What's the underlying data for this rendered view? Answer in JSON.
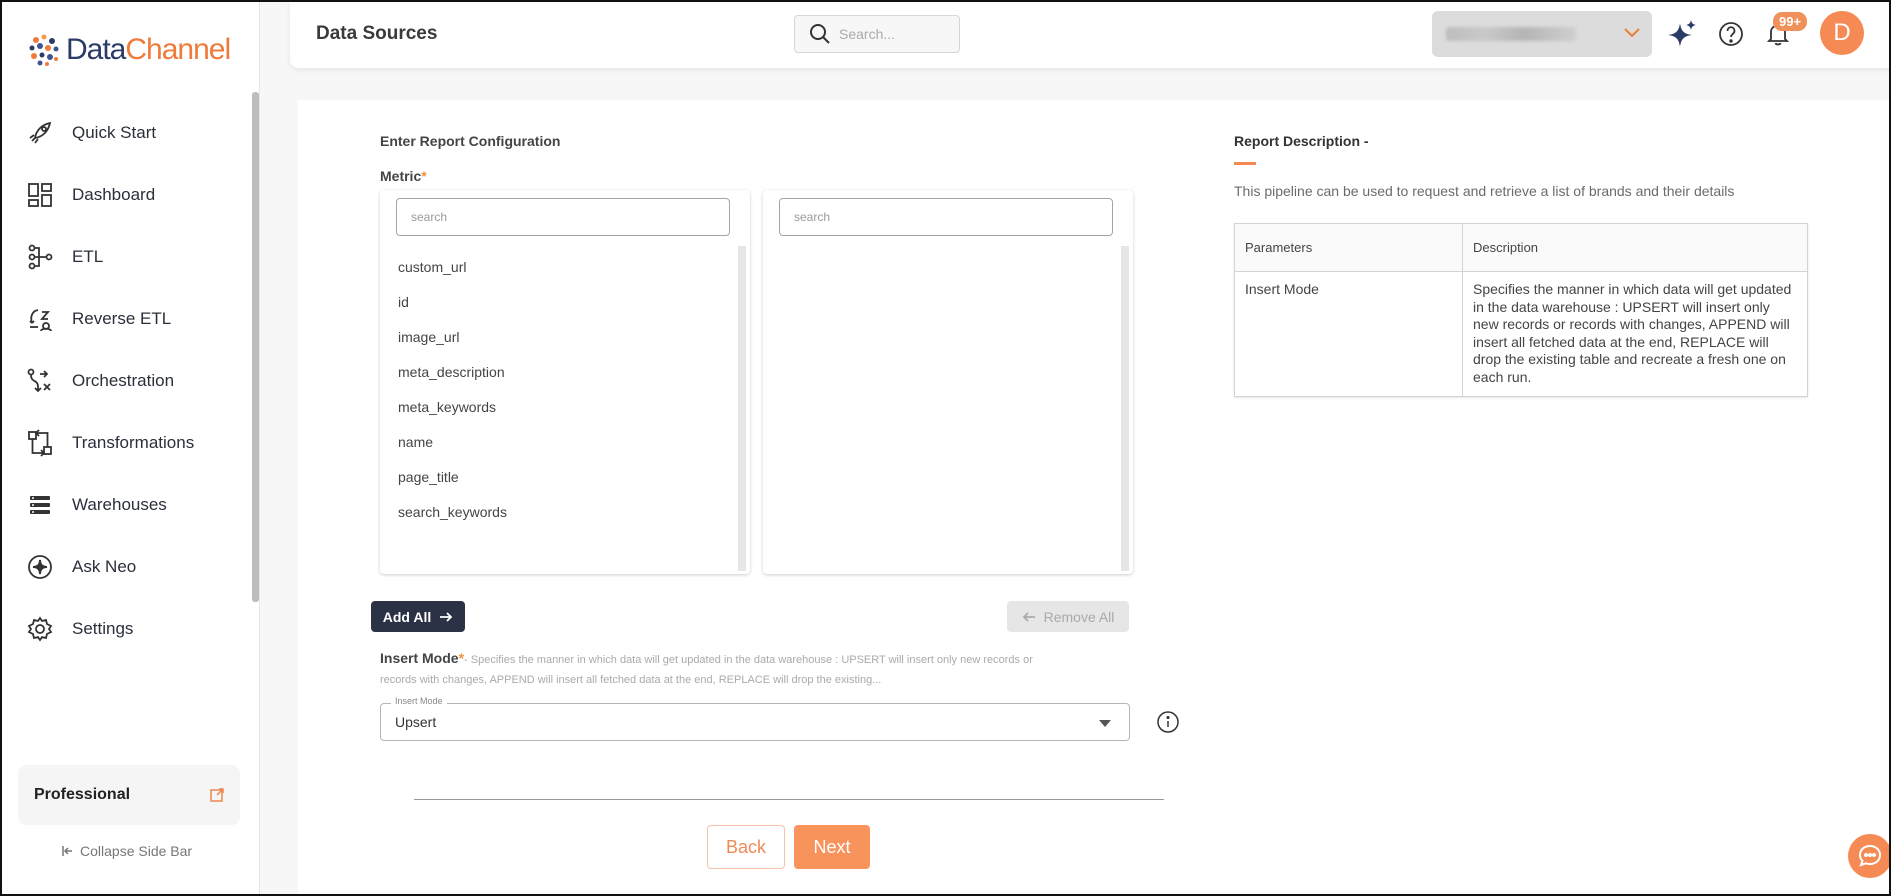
{
  "brand": {
    "name_part1": "Data",
    "name_part2": "Channel",
    "primary": "#2b3a67",
    "accent": "#ef7a3a"
  },
  "sidebar": {
    "items": [
      {
        "label": "Quick Start",
        "icon": "rocket-icon"
      },
      {
        "label": "Dashboard",
        "icon": "dashboard-icon"
      },
      {
        "label": "ETL",
        "icon": "etl-icon"
      },
      {
        "label": "Reverse ETL",
        "icon": "reverse-etl-icon"
      },
      {
        "label": "Orchestration",
        "icon": "orchestration-icon"
      },
      {
        "label": "Transformations",
        "icon": "transformations-icon"
      },
      {
        "label": "Warehouses",
        "icon": "warehouses-icon"
      },
      {
        "label": "Ask Neo",
        "icon": "sparkle-icon"
      },
      {
        "label": "Settings",
        "icon": "gear-icon"
      }
    ],
    "plan_name": "Professional",
    "collapse_label": "Collapse Side Bar"
  },
  "header": {
    "title": "Data Sources",
    "search_placeholder": "Search...",
    "notification_count": "99+",
    "avatar_initial": "D"
  },
  "config": {
    "section_title": "Enter Report Configuration",
    "metric_label": "Metric",
    "required_mark": "*",
    "available_search_placeholder": "search",
    "selected_search_placeholder": "search",
    "available_metrics": [
      "custom_url",
      "id",
      "image_url",
      "meta_description",
      "meta_keywords",
      "name",
      "page_title",
      "search_keywords"
    ],
    "add_all_label": "Add All",
    "remove_all_label": "Remove All",
    "insert_mode_label": "Insert Mode",
    "insert_mode_hint": "- Specifies the manner in which data will get updated in the data warehouse : UPSERT will insert only new records or records with changes, APPEND will insert all fetched data at the end, REPLACE will drop the existing...",
    "insert_mode_field_label": "Insert Mode",
    "insert_mode_value": "Upsert",
    "back_label": "Back",
    "next_label": "Next"
  },
  "report_description": {
    "title": "Report Description -",
    "text": "This pipeline can be used to request and retrieve a list of brands and their details",
    "columns": [
      "Parameters",
      "Description"
    ],
    "rows": [
      {
        "parameter": "Insert Mode",
        "description": "Specifies the manner in which data will get updated in the data warehouse : UPSERT will insert only new records or records with changes, APPEND will insert all fetched data at the end, REPLACE will drop the existing table and recreate a fresh one on each run."
      }
    ]
  }
}
